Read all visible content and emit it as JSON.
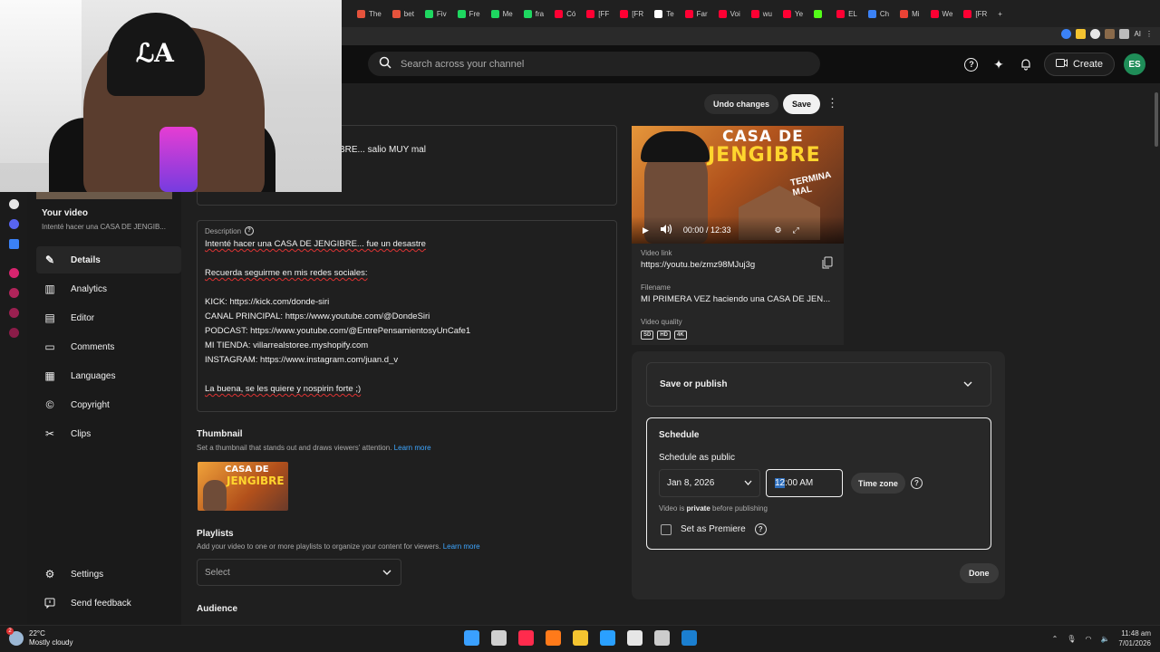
{
  "browser": {
    "tabs": [
      {
        "label": "The",
        "color": "#e5533c"
      },
      {
        "label": "bet",
        "color": "#e5533c"
      },
      {
        "label": "Fiv",
        "color": "#1ed760"
      },
      {
        "label": "Fre",
        "color": "#1ed760"
      },
      {
        "label": "Me",
        "color": "#1ed760"
      },
      {
        "label": "fra",
        "color": "#1ed760"
      },
      {
        "label": "Có",
        "color": "#ff0033"
      },
      {
        "label": "[FF",
        "color": "#ff0033"
      },
      {
        "label": "[FR",
        "color": "#ff0033"
      },
      {
        "label": "Te",
        "color": "#ffffff"
      },
      {
        "label": "Far",
        "color": "#ff0033"
      },
      {
        "label": "Voi",
        "color": "#ff0033"
      },
      {
        "label": "wu",
        "color": "#ff0033"
      },
      {
        "label": "Ye",
        "color": "#ff0033"
      },
      {
        "label": "",
        "color": "#53fc18"
      },
      {
        "label": "EL",
        "color": "#ff0033"
      },
      {
        "label": "Ch",
        "color": "#3b82f6"
      },
      {
        "label": "Mi",
        "color": "#ea4335"
      },
      {
        "label": "We",
        "color": "#ff0033"
      },
      {
        "label": "[FR",
        "color": "#ff0033"
      }
    ],
    "new_tab_icon": "plus-icon",
    "extensions_label": "AI"
  },
  "header": {
    "search_placeholder": "Search across your channel",
    "create_label": "Create",
    "avatar_initials": "ES"
  },
  "nav": {
    "your_video": "Your video",
    "video_subtitle": "Intenté hacer una CASA DE JENGIB...",
    "items": [
      {
        "label": "Details",
        "icon": "pencil-icon",
        "glyph": "✎"
      },
      {
        "label": "Analytics",
        "icon": "analytics-icon",
        "glyph": "▥"
      },
      {
        "label": "Editor",
        "icon": "editor-icon",
        "glyph": "▤"
      },
      {
        "label": "Comments",
        "icon": "comments-icon",
        "glyph": "▭"
      },
      {
        "label": "Languages",
        "icon": "languages-icon",
        "glyph": "▦"
      },
      {
        "label": "Copyright",
        "icon": "copyright-icon",
        "glyph": "©"
      },
      {
        "label": "Clips",
        "icon": "scissors-icon",
        "glyph": "✂"
      }
    ],
    "settings": "Settings",
    "feedback": "Send feedback"
  },
  "toolbar": {
    "undo_label": "Undo changes",
    "save_label": "Save"
  },
  "details": {
    "title_value": "BRE... salio MUY mal",
    "description_label": "Description",
    "description_lines": [
      "Intenté hacer una CASA DE JENGIBRE... fue un desastre",
      "",
      "Recuerda seguirme en mis redes sociales:",
      "",
      "KICK: https://kick.com/donde-siri",
      "CANAL PRINCIPAL: https://www.youtube.com/@DondeSiri",
      "PODCAST: https://www.youtube.com/@EntrePensamientosyUnCafe1",
      "MI TIENDA: villarrealstoree.myshopify.com",
      "INSTAGRAM: https://www.instagram.com/juan.d_v",
      "",
      "La buena, se les quiere y nospirin forte ;)"
    ],
    "thumbnail_title": "Thumbnail",
    "thumbnail_sub": "Set a thumbnail that stands out and draws viewers' attention.",
    "learn_more": "Learn more",
    "playlists_title": "Playlists",
    "playlists_sub": "Add your video to one or more playlists to organize your content for viewers.",
    "select_placeholder": "Select",
    "audience_title": "Audience"
  },
  "preview": {
    "time": "00:00 / 12:33",
    "video_link_label": "Video link",
    "video_link": "https://youtu.be/zmz98MJuj3g",
    "filename_label": "Filename",
    "filename": "MI PRIMERA VEZ haciendo una CASA DE JEN...",
    "quality_label": "Video quality",
    "quality_badges": [
      "SD",
      "HD",
      "4K"
    ],
    "thumb_line1": "CASA DE",
    "thumb_line2": "JENGIBRE",
    "thumb_tag": "TERMINA MAL"
  },
  "publish": {
    "collapsed_title": "Save or publish",
    "schedule_title": "Schedule",
    "schedule_as": "Schedule as public",
    "date": "Jan 8, 2026",
    "time_selected": "12",
    "time_rest": ":00 AM",
    "timezone_label": "Time zone",
    "private_note_pre": "Video is ",
    "private_note_bold": "private",
    "private_note_post": " before publishing",
    "premiere_label": "Set as Premiere",
    "done_label": "Done"
  },
  "taskbar": {
    "temp": "22°C",
    "weather": "Mostly cloudy",
    "badge": "2",
    "time": "11:48 am",
    "date": "7/01/2026",
    "apps": [
      {
        "name": "windows-start-icon",
        "color": "#3aa0ff"
      },
      {
        "name": "search-icon",
        "color": "#d0d0d0"
      },
      {
        "name": "opera-gx-icon",
        "color": "#ff2b4d"
      },
      {
        "name": "app-orange-icon",
        "color": "#ff7a1a"
      },
      {
        "name": "file-explorer-icon",
        "color": "#f4c430"
      },
      {
        "name": "store-icon",
        "color": "#2aa0ff"
      },
      {
        "name": "capcut-icon",
        "color": "#e6e6e6"
      },
      {
        "name": "app-circle-icon",
        "color": "#cccccc"
      },
      {
        "name": "steam-icon",
        "color": "#1b7fd0"
      }
    ]
  },
  "colors": {
    "accent": "#3ea6ff",
    "background": "#1f1f1f"
  }
}
